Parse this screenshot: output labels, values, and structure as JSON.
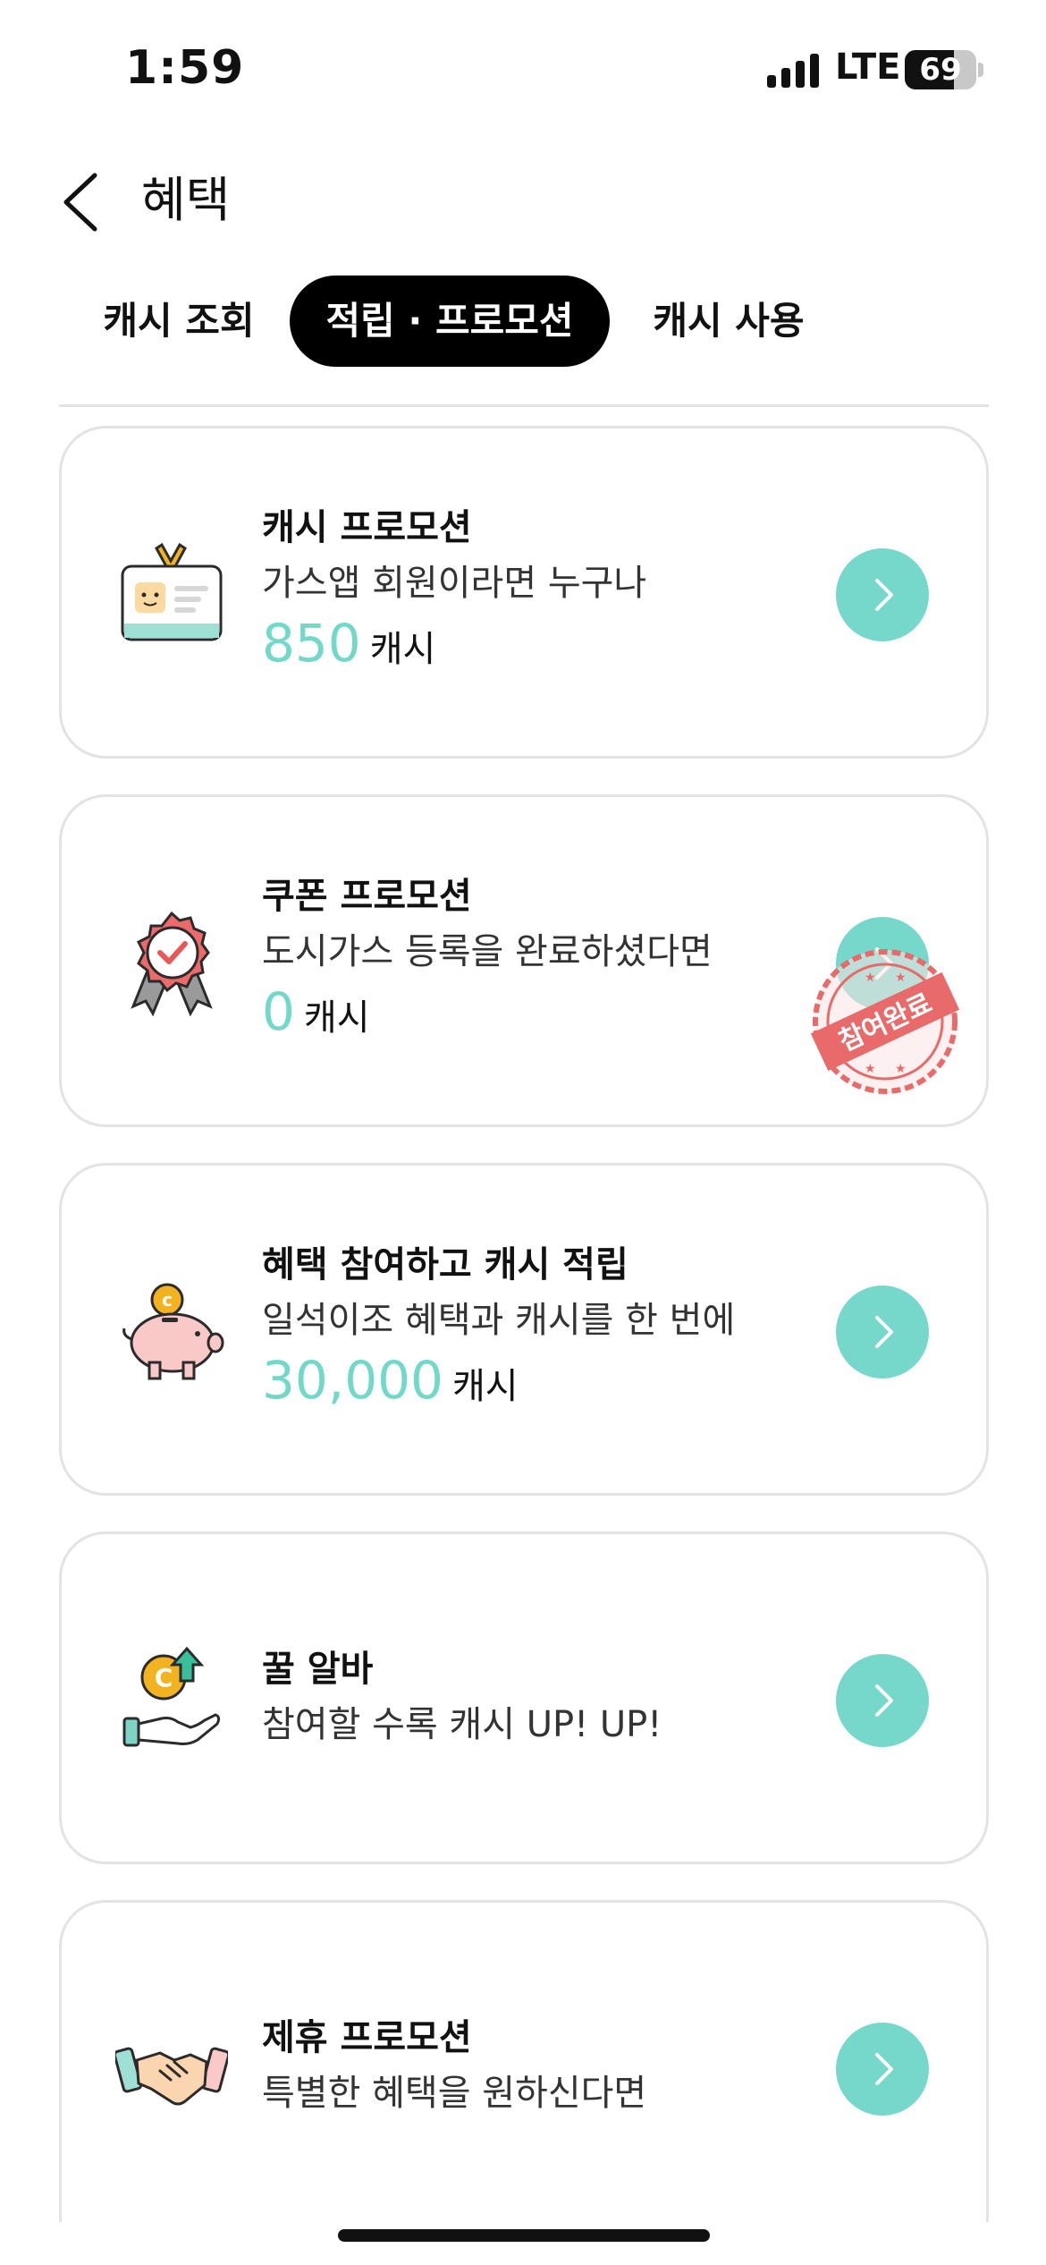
{
  "status": {
    "time": "1:59",
    "network": "LTE",
    "battery": "69",
    "battery_level": 0.69
  },
  "header": {
    "title": "혜택"
  },
  "tabs": [
    {
      "label": "캐시 조회",
      "active": false
    },
    {
      "label": "적립 · 프로모션",
      "active": true
    },
    {
      "label": "캐시 사용",
      "active": false
    }
  ],
  "cards": [
    {
      "title": "캐시 프로모션",
      "desc": "가스앱 회원이라면 누구나",
      "amount": "850",
      "unit": "캐시",
      "icon": "id-card-icon"
    },
    {
      "title": "쿠폰 프로모션",
      "desc": "도시가스 등록을 완료하셨다면",
      "amount": "0",
      "unit": "캐시",
      "icon": "award-badge-icon",
      "stamp": "참여완료"
    },
    {
      "title": "혜택 참여하고 캐시 적립",
      "desc": "일석이조 혜택과 캐시를 한 번에",
      "amount": "30,000",
      "unit": "캐시",
      "icon": "piggy-bank-icon"
    },
    {
      "title": "꿀 알바",
      "desc": "참여할 수록 캐시 UP! UP!",
      "icon": "hand-coin-icon"
    },
    {
      "title": "제휴 프로모션",
      "desc": "특별한 혜택을 원하신다면",
      "icon": "handshake-icon"
    }
  ],
  "colors": {
    "accent": "#76d7cb",
    "amount": "#72d8c8",
    "stamp": "#e86a6a",
    "tab_active_bg": "#000000"
  }
}
